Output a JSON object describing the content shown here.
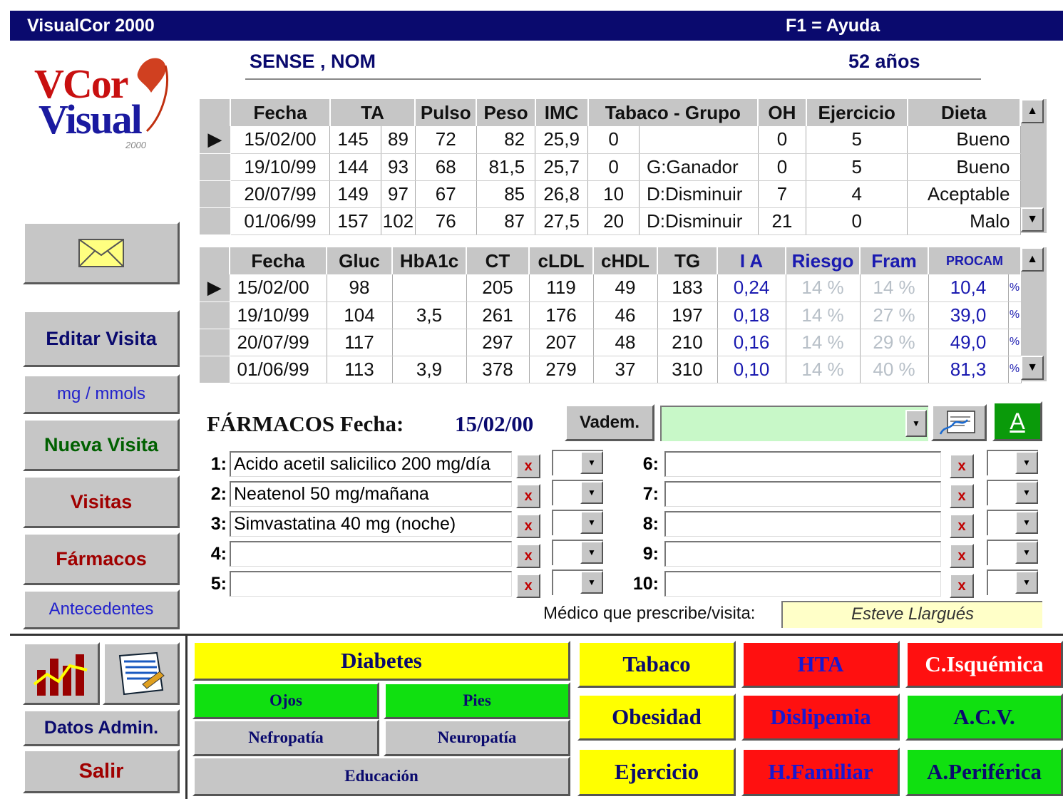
{
  "window": {
    "title": "VisualCor 2000",
    "help": "F1 = Ayuda"
  },
  "logo": {
    "text_top": "VCor",
    "text_bottom": "Visual",
    "year": "2000"
  },
  "patient": {
    "name": "SENSE , NOM",
    "age": "52 años"
  },
  "visits_table": {
    "headers": [
      "Fecha",
      "TA",
      "Pulso",
      "Peso",
      "IMC",
      "Tabaco - Grupo",
      "OH",
      "Ejercicio",
      "Dieta"
    ],
    "rows": [
      [
        "15/02/00",
        "145",
        "89",
        "72",
        "82",
        "25,9",
        "0",
        "",
        "0",
        "5",
        "Bueno"
      ],
      [
        "19/10/99",
        "144",
        "93",
        "68",
        "81,5",
        "25,7",
        "0",
        "G:Ganador",
        "0",
        "5",
        "Bueno"
      ],
      [
        "20/07/99",
        "149",
        "97",
        "67",
        "85",
        "26,8",
        "10",
        "D:Disminuir",
        "7",
        "4",
        "Aceptable"
      ],
      [
        "01/06/99",
        "157",
        "102",
        "76",
        "87",
        "27,5",
        "20",
        "D:Disminuir",
        "21",
        "0",
        "Malo"
      ]
    ]
  },
  "lab_table": {
    "headers": [
      "Fecha",
      "Gluc",
      "HbA1c",
      "CT",
      "cLDL",
      "cHDL",
      "TG",
      "I A",
      "Riesgo",
      "Fram",
      "PROCAM"
    ],
    "rows": [
      [
        "15/02/00",
        "98",
        "",
        "205",
        "119",
        "49",
        "183",
        "0,24",
        "14 %",
        "14 %",
        "10,4",
        "%"
      ],
      [
        "19/10/99",
        "104",
        "3,5",
        "261",
        "176",
        "46",
        "197",
        "0,18",
        "14 %",
        "27 %",
        "39,0",
        "%"
      ],
      [
        "20/07/99",
        "117",
        "",
        "297",
        "207",
        "48",
        "210",
        "0,16",
        "14 %",
        "29 %",
        "49,0",
        "%"
      ],
      [
        "01/06/99",
        "113",
        "3,9",
        "378",
        "279",
        "37",
        "310",
        "0,10",
        "14 %",
        "40 %",
        "81,3",
        "%"
      ]
    ]
  },
  "sidebar": {
    "editar": "Editar Visita",
    "units": "mg / mmols",
    "nueva": "Nueva Visita",
    "visitas": "Visitas",
    "farmacos": "Fármacos",
    "antecedentes": "Antecedentes",
    "datos_admin": "Datos Admin.",
    "salir": "Salir"
  },
  "farmacos": {
    "title": "FÁRMACOS Fecha:",
    "date": "15/02/00",
    "vademecum": "Vadem.",
    "font_button": "A",
    "x_label": "x",
    "items": [
      {
        "num": "1:",
        "value": "Acido acetil salicilico 200 mg/día"
      },
      {
        "num": "2:",
        "value": "Neatenol 50 mg/mañana"
      },
      {
        "num": "3:",
        "value": "Simvastatina 40 mg (noche)"
      },
      {
        "num": "4:",
        "value": ""
      },
      {
        "num": "5:",
        "value": ""
      },
      {
        "num": "6:",
        "value": ""
      },
      {
        "num": "7:",
        "value": ""
      },
      {
        "num": "8:",
        "value": ""
      },
      {
        "num": "9:",
        "value": ""
      },
      {
        "num": "10:",
        "value": ""
      }
    ],
    "medico_label": "Médico que prescribe/visita:",
    "medico_value": "Esteve Llargués"
  },
  "categories": {
    "diabetes": "Diabetes",
    "ojos": "Ojos",
    "pies": "Pies",
    "nefropatia": "Nefropatía",
    "neuropatia": "Neuropatía",
    "educacion": "Educación",
    "tabaco": "Tabaco",
    "obesidad": "Obesidad",
    "ejercicio": "Ejercicio",
    "hta": "HTA",
    "dislipemia": "Dislipemia",
    "hfamiliar": "H.Familiar",
    "cisquemica": "C.Isquémica",
    "acv": "A.C.V.",
    "aperiferica": "A.Periférica"
  }
}
